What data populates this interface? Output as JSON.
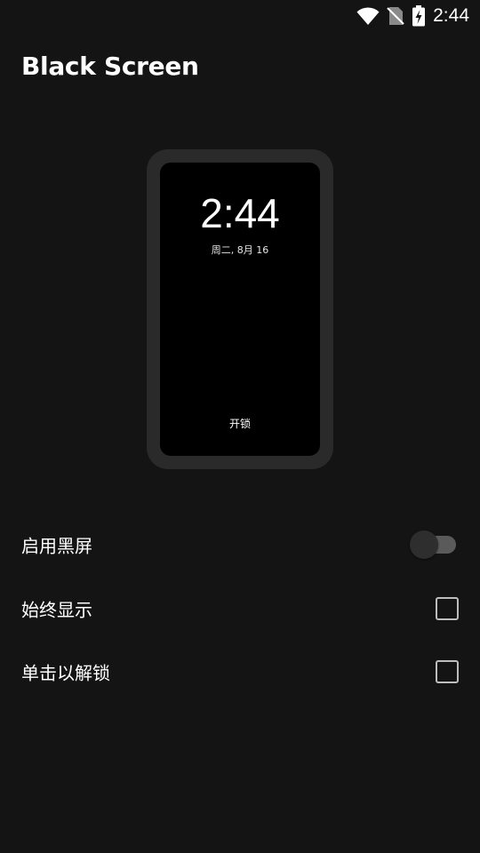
{
  "status_bar": {
    "time": "2:44",
    "icons": [
      "wifi-icon",
      "no-sim-icon",
      "battery-charging-icon"
    ]
  },
  "app": {
    "title": "Black Screen"
  },
  "preview": {
    "clock": "2:44",
    "date": "周二, 8月 16",
    "unlock_label": "开锁"
  },
  "settings": {
    "enable_black_screen": {
      "label": "启用黑屏",
      "checked": false
    },
    "always_show": {
      "label": "始终显示",
      "checked": false
    },
    "tap_to_unlock": {
      "label": "单击以解锁",
      "checked": false
    }
  },
  "colors": {
    "background": "#141414",
    "phone_frame": "#2a2a2a",
    "phone_screen": "#000000",
    "text": "#ffffff"
  }
}
